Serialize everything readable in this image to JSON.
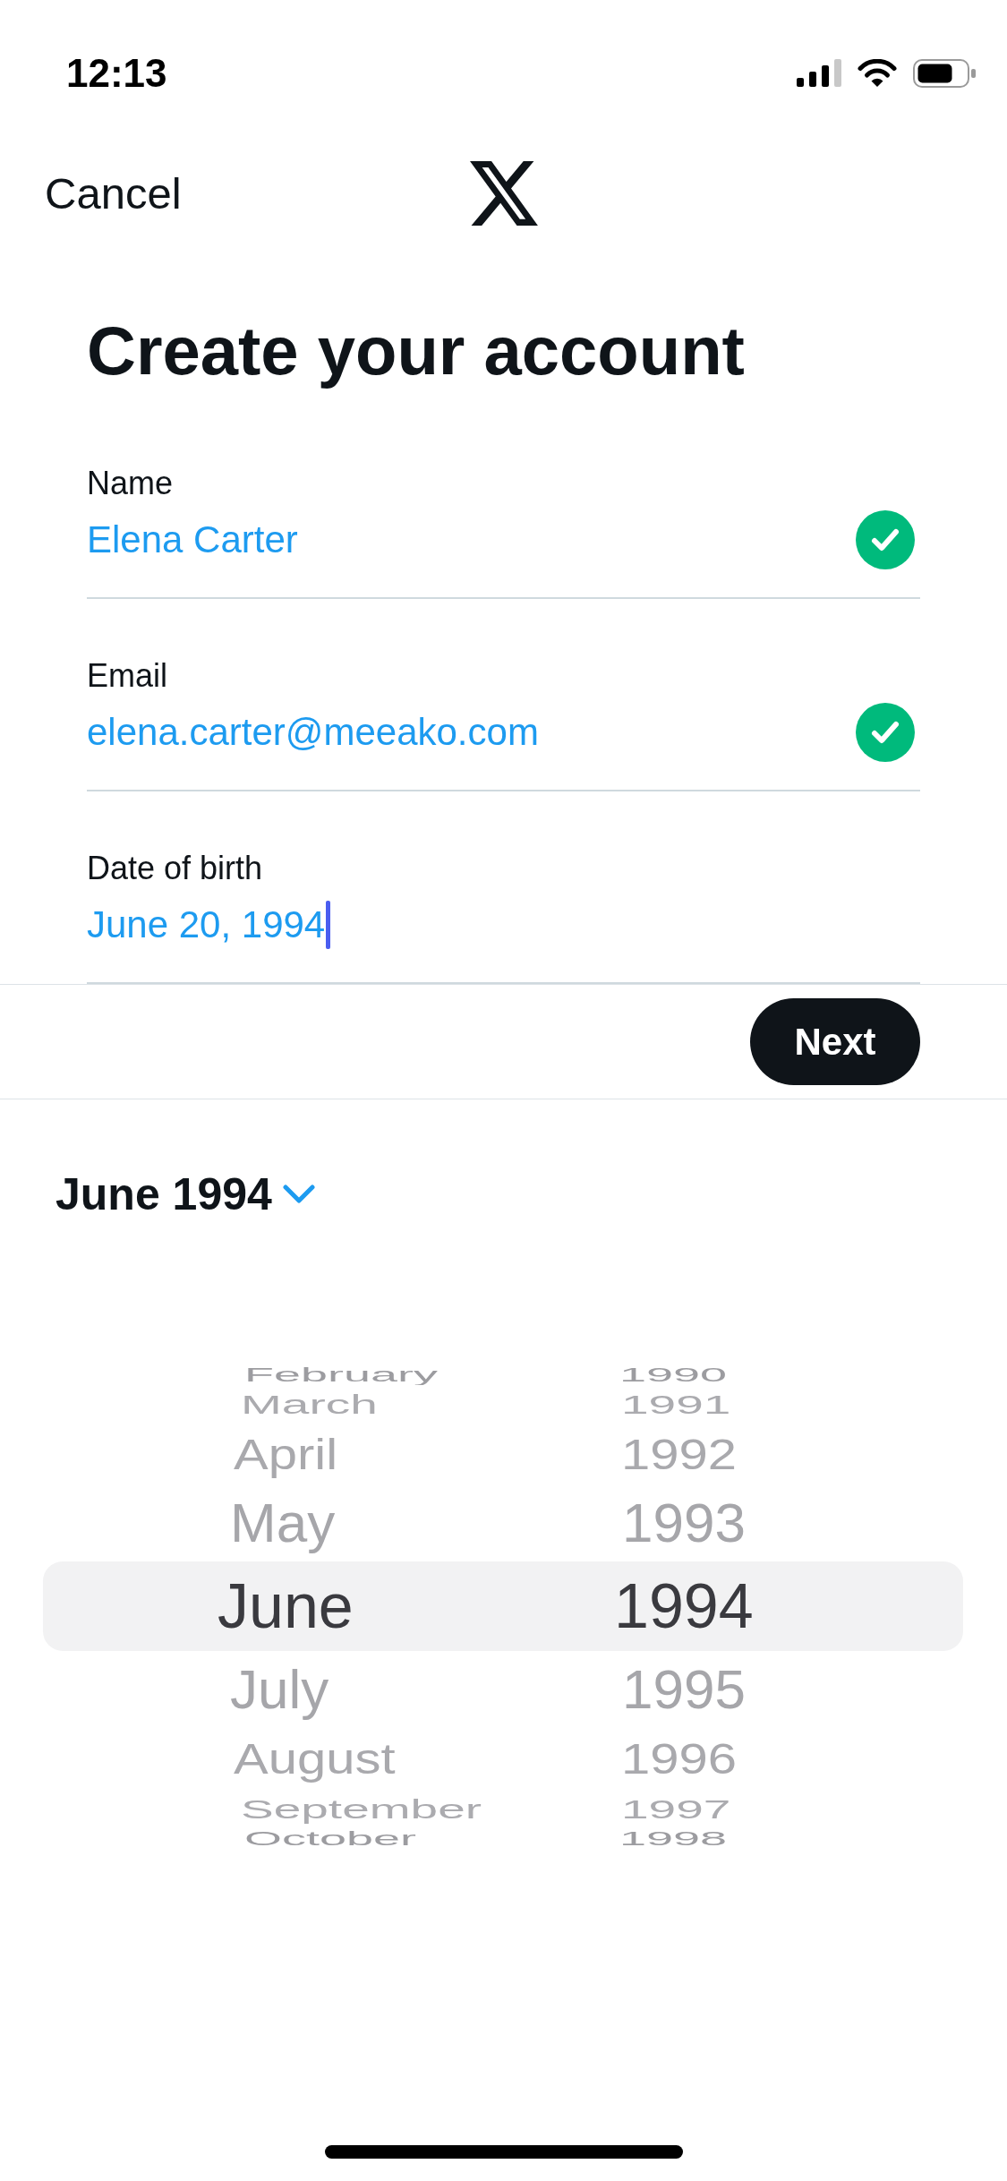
{
  "status_bar": {
    "time": "12:13"
  },
  "nav": {
    "cancel": "Cancel"
  },
  "title": "Create your account",
  "fields": [
    {
      "label": "Name",
      "value": "Elena Carter",
      "valid": true,
      "focused": false
    },
    {
      "label": "Email",
      "value": "elena.carter@meeako.com",
      "valid": true,
      "focused": false
    },
    {
      "label": "Date of birth",
      "value": "June 20, 1994",
      "valid": false,
      "focused": true
    }
  ],
  "next_button": {
    "label": "Next"
  },
  "calendar_header": {
    "label": "June 1994"
  },
  "picker": {
    "months": [
      {
        "label": "February",
        "selected": false
      },
      {
        "label": "March",
        "selected": false
      },
      {
        "label": "April",
        "selected": false
      },
      {
        "label": "May",
        "selected": false
      },
      {
        "label": "June",
        "selected": true
      },
      {
        "label": "July",
        "selected": false
      },
      {
        "label": "August",
        "selected": false
      },
      {
        "label": "September",
        "selected": false
      },
      {
        "label": "October",
        "selected": false
      }
    ],
    "years": [
      {
        "label": "1990",
        "selected": false
      },
      {
        "label": "1991",
        "selected": false
      },
      {
        "label": "1992",
        "selected": false
      },
      {
        "label": "1993",
        "selected": false
      },
      {
        "label": "1994",
        "selected": true
      },
      {
        "label": "1995",
        "selected": false
      },
      {
        "label": "1996",
        "selected": false
      },
      {
        "label": "1997",
        "selected": false
      },
      {
        "label": "1998",
        "selected": false
      }
    ]
  }
}
